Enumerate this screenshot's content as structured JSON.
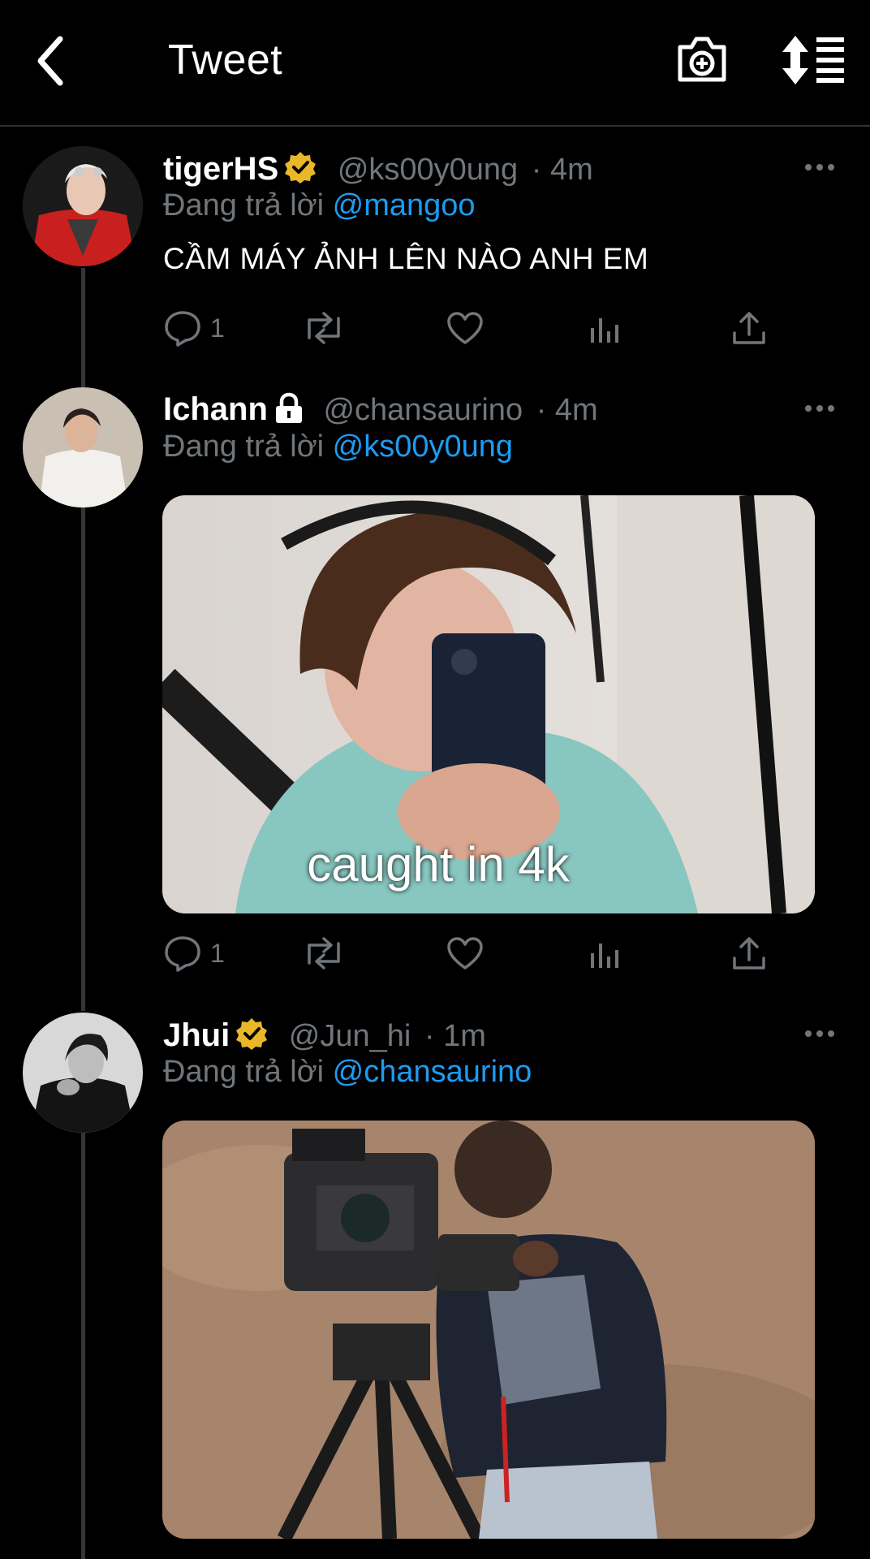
{
  "header": {
    "title": "Tweet"
  },
  "tweets": [
    {
      "name": "tigerHS",
      "handle": "@ks00y0ung",
      "time": "· 4m",
      "reply_prefix": "Đang trả lời",
      "reply_to": "@mangoo",
      "text": "CẦM MÁY ẢNH LÊN NÀO ANH EM",
      "reply_count": "1",
      "verified": true
    },
    {
      "name": "Ichann",
      "handle": "@chansaurino",
      "time": "· 4m",
      "reply_prefix": "Đang trả lời",
      "reply_to": "@ks00y0ung",
      "media_caption": "caught in 4k",
      "reply_count": "1",
      "locked": true
    },
    {
      "name": "Jhui",
      "handle": "@Jun_hi",
      "time": "· 1m",
      "reply_prefix": "Đang trả lời",
      "reply_to": "@chansaurino",
      "verified": true
    }
  ],
  "colors": {
    "background": "#000000",
    "muted": "#71767b",
    "link": "#1d9bf0",
    "verified": "#e8b828"
  },
  "icons": [
    "back-arrow-icon",
    "camera-plus-icon",
    "sort-icon",
    "more-icon",
    "reply-icon",
    "retweet-icon",
    "like-icon",
    "views-icon",
    "share-icon",
    "verified-badge-icon",
    "lock-icon"
  ]
}
